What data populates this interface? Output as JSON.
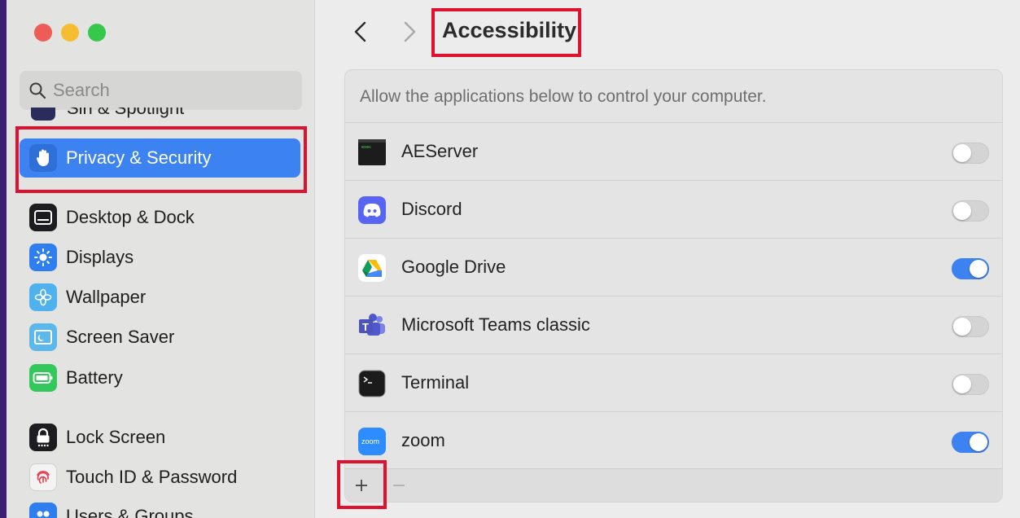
{
  "window": {
    "controls": [
      "close",
      "minimize",
      "zoom"
    ]
  },
  "sidebar": {
    "search": {
      "placeholder": "Search"
    },
    "partial_item": {
      "label": "Siri & Spotlight",
      "icon": "siri-icon"
    },
    "items": [
      {
        "label": "Privacy & Security",
        "icon": "hand-icon",
        "selected": true
      },
      {
        "label": "Desktop & Dock",
        "icon": "dock-icon"
      },
      {
        "label": "Displays",
        "icon": "sun-icon"
      },
      {
        "label": "Wallpaper",
        "icon": "flower-icon"
      },
      {
        "label": "Screen Saver",
        "icon": "screen-saver-icon"
      },
      {
        "label": "Battery",
        "icon": "battery-icon"
      },
      {
        "label": "Lock Screen",
        "icon": "lock-icon"
      },
      {
        "label": "Touch ID & Password",
        "icon": "fingerprint-icon"
      },
      {
        "label": "Users & Groups",
        "icon": "users-icon"
      }
    ]
  },
  "header": {
    "title": "Accessibility"
  },
  "panel": {
    "description": "Allow the applications below to control your computer.",
    "apps": [
      {
        "name": "AEServer",
        "icon": "exec-icon",
        "enabled": false
      },
      {
        "name": "Discord",
        "icon": "discord-icon",
        "enabled": false
      },
      {
        "name": "Google Drive",
        "icon": "google-drive-icon",
        "enabled": true
      },
      {
        "name": "Microsoft Teams classic",
        "icon": "teams-icon",
        "enabled": false
      },
      {
        "name": "Terminal",
        "icon": "terminal-icon",
        "enabled": false
      },
      {
        "name": "zoom",
        "icon": "zoom-icon",
        "enabled": true
      }
    ],
    "add_label": "+",
    "remove_label": "−"
  },
  "colors": {
    "accent": "#3c82f0",
    "highlight": "#e0102f",
    "background": "#3a1f73"
  }
}
